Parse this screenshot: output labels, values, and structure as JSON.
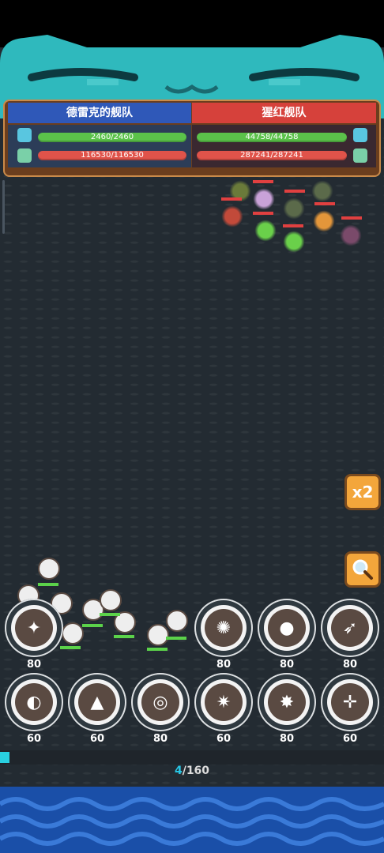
{
  "left_team": {
    "name": "德雷克的舰队",
    "hp": "2460/2460",
    "hp_fraction": 1.0,
    "power": "116530/116530",
    "power_fraction": 1.0
  },
  "right_team": {
    "name": "猩红舰队",
    "hp": "44758/44758",
    "hp_fraction": 1.0,
    "power": "287241/287241",
    "power_fraction": 1.0
  },
  "speed_button": {
    "label": "x2"
  },
  "zoom_button": {
    "icon": "magnifier-icon"
  },
  "skills": [
    {
      "cost": "80",
      "icon": "dagger-fan-icon"
    },
    {
      "cost": "80",
      "icon": "crab-icon"
    },
    {
      "cost": "80",
      "icon": "cannonball-icon"
    },
    {
      "cost": "80",
      "icon": "fire-shot-icon"
    },
    {
      "cost": "60",
      "icon": "shell-icon"
    },
    {
      "cost": "60",
      "icon": "shark-icon"
    },
    {
      "cost": "80",
      "icon": "whirlpool-icon"
    },
    {
      "cost": "60",
      "icon": "star-burst-icon"
    },
    {
      "cost": "80",
      "icon": "explosion-icon"
    },
    {
      "cost": "60",
      "icon": "compass-icon"
    }
  ],
  "progress": {
    "current": "4",
    "total": "/160",
    "fraction": 0.025
  },
  "colors": {
    "ally_banner": "#2f58b8",
    "enemy_banner": "#d6413b",
    "hp_bar": "#5bc24a",
    "power_bar": "#e0534a",
    "progress": "#29d0e0",
    "accent_button": "#f3a63b"
  }
}
